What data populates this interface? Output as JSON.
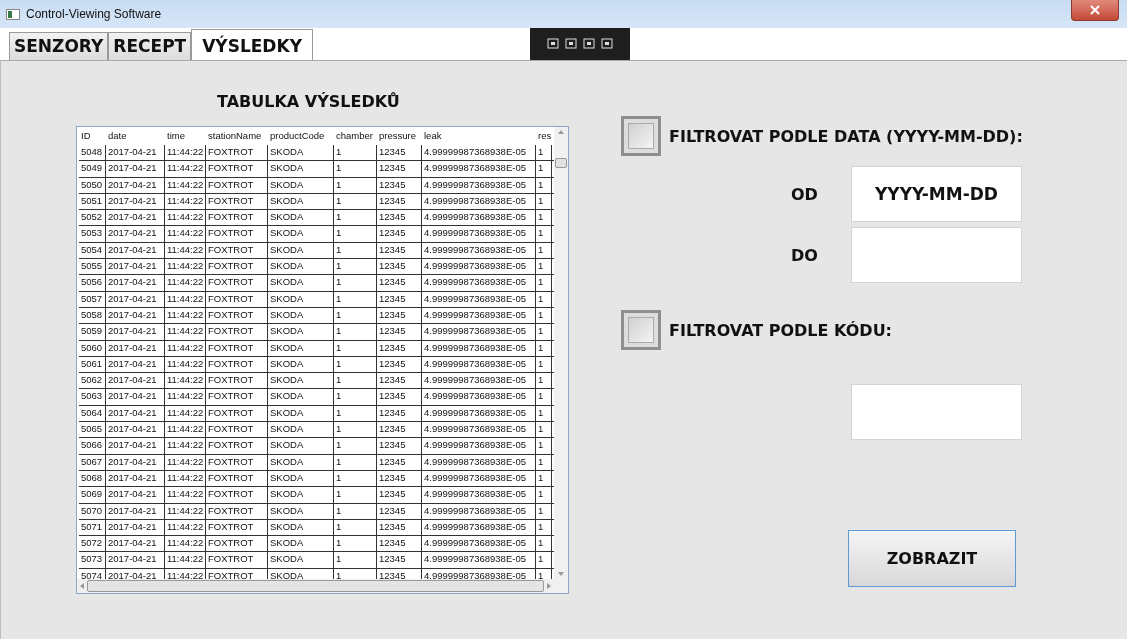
{
  "window": {
    "title": "Control-Viewing Software"
  },
  "tabs": [
    {
      "label": "SENZORY",
      "selected": false
    },
    {
      "label": "RECEPT",
      "selected": false
    },
    {
      "label": "VÝSLEDKY",
      "selected": true
    }
  ],
  "results": {
    "title": "TABULKA VÝSLEDKŮ",
    "table": {
      "columns": [
        "ID",
        "date",
        "time",
        "stationName",
        "productCode",
        "chamber",
        "pressure",
        "leak",
        "res"
      ],
      "rows": [
        [
          "5048",
          "2017-04-21",
          "11:44:22",
          "FOXTROT",
          "SKODA",
          "1",
          "12345",
          "4.99999987368938E-05",
          "1"
        ],
        [
          "5049",
          "2017-04-21",
          "11:44:22",
          "FOXTROT",
          "SKODA",
          "1",
          "12345",
          "4.99999987368938E-05",
          "1"
        ],
        [
          "5050",
          "2017-04-21",
          "11:44:22",
          "FOXTROT",
          "SKODA",
          "1",
          "12345",
          "4.99999987368938E-05",
          "1"
        ],
        [
          "5051",
          "2017-04-21",
          "11:44:22",
          "FOXTROT",
          "SKODA",
          "1",
          "12345",
          "4.99999987368938E-05",
          "1"
        ],
        [
          "5052",
          "2017-04-21",
          "11:44:22",
          "FOXTROT",
          "SKODA",
          "1",
          "12345",
          "4.99999987368938E-05",
          "1"
        ],
        [
          "5053",
          "2017-04-21",
          "11:44:22",
          "FOXTROT",
          "SKODA",
          "1",
          "12345",
          "4.99999987368938E-05",
          "1"
        ],
        [
          "5054",
          "2017-04-21",
          "11:44:22",
          "FOXTROT",
          "SKODA",
          "1",
          "12345",
          "4.99999987368938E-05",
          "1"
        ],
        [
          "5055",
          "2017-04-21",
          "11:44:22",
          "FOXTROT",
          "SKODA",
          "1",
          "12345",
          "4.99999987368938E-05",
          "1"
        ],
        [
          "5056",
          "2017-04-21",
          "11:44:22",
          "FOXTROT",
          "SKODA",
          "1",
          "12345",
          "4.99999987368938E-05",
          "1"
        ],
        [
          "5057",
          "2017-04-21",
          "11:44:22",
          "FOXTROT",
          "SKODA",
          "1",
          "12345",
          "4.99999987368938E-05",
          "1"
        ],
        [
          "5058",
          "2017-04-21",
          "11:44:22",
          "FOXTROT",
          "SKODA",
          "1",
          "12345",
          "4.99999987368938E-05",
          "1"
        ],
        [
          "5059",
          "2017-04-21",
          "11:44:22",
          "FOXTROT",
          "SKODA",
          "1",
          "12345",
          "4.99999987368938E-05",
          "1"
        ],
        [
          "5060",
          "2017-04-21",
          "11:44:22",
          "FOXTROT",
          "SKODA",
          "1",
          "12345",
          "4.99999987368938E-05",
          "1"
        ],
        [
          "5061",
          "2017-04-21",
          "11:44:22",
          "FOXTROT",
          "SKODA",
          "1",
          "12345",
          "4.99999987368938E-05",
          "1"
        ],
        [
          "5062",
          "2017-04-21",
          "11:44:22",
          "FOXTROT",
          "SKODA",
          "1",
          "12345",
          "4.99999987368938E-05",
          "1"
        ],
        [
          "5063",
          "2017-04-21",
          "11:44:22",
          "FOXTROT",
          "SKODA",
          "1",
          "12345",
          "4.99999987368938E-05",
          "1"
        ],
        [
          "5064",
          "2017-04-21",
          "11:44:22",
          "FOXTROT",
          "SKODA",
          "1",
          "12345",
          "4.99999987368938E-05",
          "1"
        ],
        [
          "5065",
          "2017-04-21",
          "11:44:22",
          "FOXTROT",
          "SKODA",
          "1",
          "12345",
          "4.99999987368938E-05",
          "1"
        ],
        [
          "5066",
          "2017-04-21",
          "11:44:22",
          "FOXTROT",
          "SKODA",
          "1",
          "12345",
          "4.99999987368938E-05",
          "1"
        ],
        [
          "5067",
          "2017-04-21",
          "11:44:22",
          "FOXTROT",
          "SKODA",
          "1",
          "12345",
          "4.99999987368938E-05",
          "1"
        ],
        [
          "5068",
          "2017-04-21",
          "11:44:22",
          "FOXTROT",
          "SKODA",
          "1",
          "12345",
          "4.99999987368938E-05",
          "1"
        ],
        [
          "5069",
          "2017-04-21",
          "11:44:22",
          "FOXTROT",
          "SKODA",
          "1",
          "12345",
          "4.99999987368938E-05",
          "1"
        ],
        [
          "5070",
          "2017-04-21",
          "11:44:22",
          "FOXTROT",
          "SKODA",
          "1",
          "12345",
          "4.99999987368938E-05",
          "1"
        ],
        [
          "5071",
          "2017-04-21",
          "11:44:22",
          "FOXTROT",
          "SKODA",
          "1",
          "12345",
          "4.99999987368938E-05",
          "1"
        ],
        [
          "5072",
          "2017-04-21",
          "11:44:22",
          "FOXTROT",
          "SKODA",
          "1",
          "12345",
          "4.99999987368938E-05",
          "1"
        ],
        [
          "5073",
          "2017-04-21",
          "11:44:22",
          "FOXTROT",
          "SKODA",
          "1",
          "12345",
          "4.99999987368938E-05",
          "1"
        ],
        [
          "5074",
          "2017-04-21",
          "11:44:22",
          "FOXTROT",
          "SKODA",
          "1",
          "12345",
          "4.99999987368938E-05",
          "1"
        ]
      ]
    }
  },
  "filters": {
    "date": {
      "checked": false,
      "label": "FILTROVAT PODLE DATA (YYYY-MM-DD):",
      "from_label": "OD",
      "from_value": "YYYY-MM-DD",
      "to_label": "DO"
    },
    "code": {
      "checked": false,
      "label": "FILTROVAT PODLE KÓDU:"
    }
  },
  "buttons": [
    "ZOBRAZIT"
  ]
}
